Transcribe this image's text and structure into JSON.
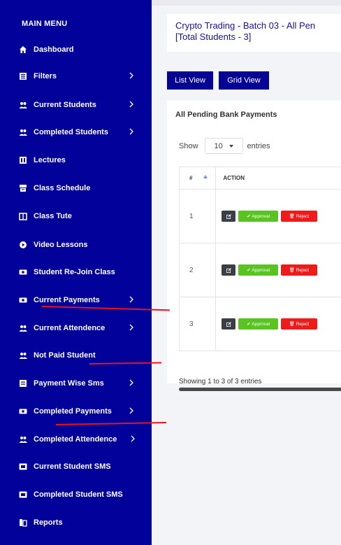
{
  "sidebar": {
    "title": "MAIN MENU",
    "items": [
      {
        "label": "Dashboard",
        "icon": "home-icon",
        "chevron": false
      },
      {
        "label": "Filters",
        "icon": "list-icon",
        "chevron": true
      },
      {
        "label": "Current Students",
        "icon": "users-icon",
        "chevron": true
      },
      {
        "label": "Completed Students",
        "icon": "users-icon",
        "chevron": true
      },
      {
        "label": "Lectures",
        "icon": "lectures-icon",
        "chevron": false
      },
      {
        "label": "Class Schedule",
        "icon": "schedule-icon",
        "chevron": false
      },
      {
        "label": "Class Tute",
        "icon": "book-icon",
        "chevron": false
      },
      {
        "label": "Video Lessons",
        "icon": "play-icon",
        "chevron": false
      },
      {
        "label": "Student Re-Join Class",
        "icon": "money-icon",
        "chevron": false
      },
      {
        "label": "Current Payments",
        "icon": "money-icon",
        "chevron": true
      },
      {
        "label": "Current Attendence",
        "icon": "users-icon",
        "chevron": true
      },
      {
        "label": "Not Paid Student",
        "icon": "users-icon",
        "chevron": false
      },
      {
        "label": "Payment Wise Sms",
        "icon": "message-icon",
        "chevron": true
      },
      {
        "label": "Completed Payments",
        "icon": "money-icon",
        "chevron": true
      },
      {
        "label": "Completed Attendence",
        "icon": "users-icon",
        "chevron": true
      },
      {
        "label": "Current Student SMS",
        "icon": "sms-icon",
        "chevron": false
      },
      {
        "label": "Completed Student SMS",
        "icon": "sms-icon",
        "chevron": false
      },
      {
        "label": "Reports",
        "icon": "reports-icon",
        "chevron": false
      }
    ]
  },
  "header": {
    "title_line1": "Crypto Trading - Batch 03 - All Pen",
    "title_line2": "[Total Students - 3]"
  },
  "views": {
    "list_label": "List View",
    "grid_label": "Grid View"
  },
  "card": {
    "title": "All Pending Bank Payments",
    "show_label": "Show",
    "entries_value": "10",
    "entries_label": "entries",
    "columns": [
      "#",
      "ACTION"
    ],
    "rows": [
      {
        "num": "1"
      },
      {
        "num": "2"
      },
      {
        "num": "3"
      }
    ],
    "approval_label": "Approval",
    "reject_label": "Reject",
    "showing_text": "Showing 1 to 3 of 3 entries"
  },
  "colors": {
    "sidebar_bg": "#02019a",
    "accent": "#050494",
    "approve": "#59c41f",
    "reject": "#ef1b1b",
    "annotation": "#e8141c"
  }
}
